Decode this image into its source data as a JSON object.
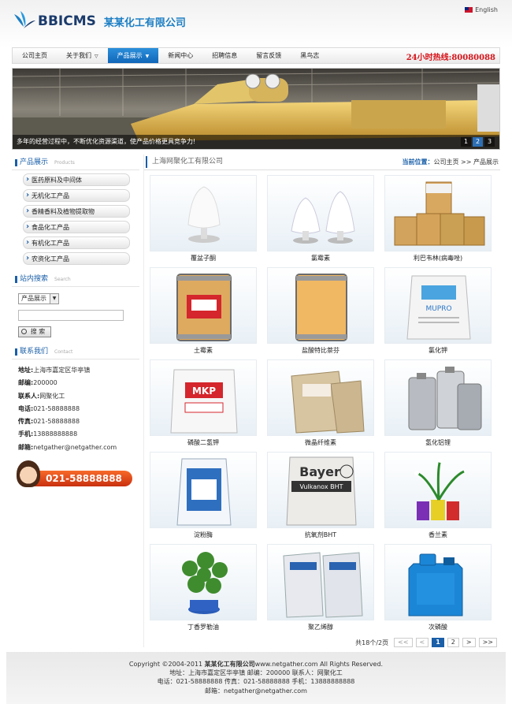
{
  "header": {
    "logo_text": "BBICMS",
    "company_name": "某某化工有限公司",
    "language": "English"
  },
  "nav": {
    "items": [
      {
        "label": "公司主页"
      },
      {
        "label": "关于我们"
      },
      {
        "label": "产品展示"
      },
      {
        "label": "新闻中心"
      },
      {
        "label": "招聘信息"
      },
      {
        "label": "留言反馈"
      },
      {
        "label": "黑鸟志"
      }
    ],
    "active_index": 2,
    "hotline": "24小时热线:80080088"
  },
  "banner": {
    "caption": "多年的经营过程中，不断优化资源渠道，使产品价格更具竞争力!",
    "dots": [
      "1",
      "2",
      "3"
    ],
    "active_dot": 1,
    "edge_number": "3"
  },
  "sidebar": {
    "products_title": "产品展示",
    "products_title_en": "Products",
    "categories": [
      "医药原料及中间体",
      "无机化工产品",
      "香精香料及植物提取物",
      "食品化工产品",
      "有机化工产品",
      "农资化工产品"
    ],
    "search_title": "站内搜索",
    "search_title_en": "Search",
    "search_select": "产品展示",
    "search_button": "搜 索",
    "contact_title": "联系我们",
    "contact_title_en": "Contact",
    "contact": [
      {
        "label": "地址:",
        "value": "上海市嘉定区华亭镇"
      },
      {
        "label": "邮编:",
        "value": "200000"
      },
      {
        "label": "联系人:",
        "value": "网聚化工"
      },
      {
        "label": "电话:",
        "value": "021-58888888"
      },
      {
        "label": "传真:",
        "value": "021-58888888"
      },
      {
        "label": "手机:",
        "value": "13888888888"
      },
      {
        "label": "邮箱:",
        "value": "netgather@netgather.com"
      }
    ],
    "hotline_banner": "021-58888888"
  },
  "main": {
    "title": "上海网聚化工有限公司",
    "crumb_label": "当前位置：",
    "crumb_path": "公司主页 >> 产品展示",
    "products": [
      {
        "name": "覆盆子酮",
        "icon": "powder-heap"
      },
      {
        "name": "氯霉素",
        "icon": "powder-pair"
      },
      {
        "name": "利巴韦林(病毒唑)",
        "icon": "cardboard-drums"
      },
      {
        "name": "土霉素",
        "icon": "drum-red-label"
      },
      {
        "name": "盐酸特比萘芬",
        "icon": "drum-plain"
      },
      {
        "name": "氯化钾",
        "icon": "bag-mupro"
      },
      {
        "name": "磷酸二氢钾",
        "icon": "bag-mkp"
      },
      {
        "name": "微晶纤维素",
        "icon": "bags-stack"
      },
      {
        "name": "氢化铝锂",
        "icon": "steel-cans"
      },
      {
        "name": "淀粉酶",
        "icon": "bag-blue"
      },
      {
        "name": "抗氧剂BHT",
        "icon": "bag-bayer"
      },
      {
        "name": "香兰素",
        "icon": "potted-flowers"
      },
      {
        "name": "丁香罗勒油",
        "icon": "potted-plant"
      },
      {
        "name": "聚乙烯醇",
        "icon": "bags-pair"
      },
      {
        "name": "次磷酸",
        "icon": "blue-jerrycan"
      }
    ],
    "bayer_text": "Bayer",
    "bayer_sub": "Vulkanox BHT",
    "mkp_text": "MKP",
    "mupro_text": "MUPRO",
    "pager": {
      "total": "共18个/2页",
      "first": "<<",
      "prev": "<",
      "pages": [
        "1",
        "2"
      ],
      "current": "1",
      "next": ">",
      "last": ">>"
    }
  },
  "footer": {
    "line1_prefix": "Copyright ©2004-2011 ",
    "line1_company": "某某化工有限公司",
    "line1_suffix": "www.netgather.com All Rights Reserved.",
    "line2": "地址：上海市嘉定区华亭镇    邮编：200000    联系人：网聚化工",
    "line3": "电话：021-58888888    传真：021-58888888    手机：13888888888",
    "line4": "邮箱：netgather@netgather.com"
  },
  "colors": {
    "brand_blue": "#1a5fa8",
    "nav_active": "#1d7fd0",
    "hotline_red": "#d6141a",
    "hotline_orange": "#e8501f"
  }
}
